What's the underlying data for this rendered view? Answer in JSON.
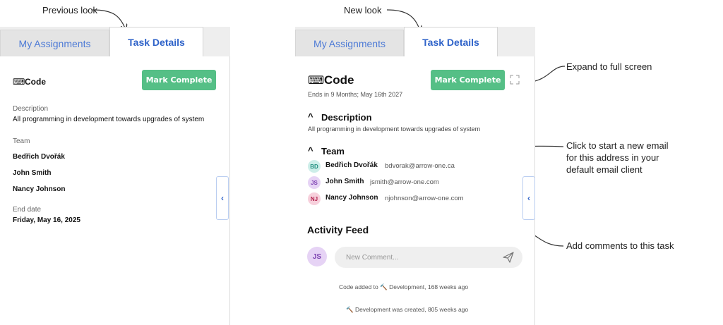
{
  "annotations": {
    "previous_look": "Previous look",
    "new_look": "New look",
    "expand": "Expand to full screen",
    "email_line1": "Click to start a new email",
    "email_line2": "for this address in your",
    "email_line3": "default email client",
    "comments": "Add comments to this task"
  },
  "tabs": {
    "assignments": "My Assignments",
    "details": "Task Details"
  },
  "old_panel": {
    "task_name": "Code",
    "button": "Mark Complete",
    "description_label": "Description",
    "description_text": "All programming in development towards upgrades of system",
    "team_label": "Team",
    "team": [
      "Bedřich Dvořák",
      "John Smith",
      "Nancy Johnson"
    ],
    "end_date_label": "End date",
    "end_date": "Friday, May 16, 2025"
  },
  "new_panel": {
    "task_name": "Code",
    "button": "Mark Complete",
    "subtitle": "Ends in 9 Months; May 16th 2027",
    "description_label": "Description",
    "description_text": "All programming in development towards upgrades of system",
    "team_label": "Team",
    "team": [
      {
        "initials": "BD",
        "name": "Bedřich Dvořák",
        "email": "bdvorak@arrow-one.ca",
        "bg": "#cdeee9",
        "fg": "#1f8f7f"
      },
      {
        "initials": "JS",
        "name": "John Smith",
        "email": "jsmith@arrow-one.com",
        "bg": "#e6d3f5",
        "fg": "#7b3fb0"
      },
      {
        "initials": "NJ",
        "name": "Nancy Johnson",
        "email": "njohnson@arrow-one.com",
        "bg": "#f7d0dc",
        "fg": "#b2244f"
      }
    ],
    "activity_title": "Activity Feed",
    "user_initials": "JS",
    "comment_placeholder": "New Comment...",
    "feed": [
      "Code added to 🔨 Development, 168 weeks ago",
      "🔨 Development was created, 805 weeks ago"
    ]
  },
  "colors": {
    "accent": "#2f63c9",
    "success": "#55bf86"
  },
  "icons": [
    "keyboard-icon",
    "chevron-up-icon",
    "chevron-left-icon",
    "expand-icon",
    "send-icon",
    "hammer-icon"
  ]
}
